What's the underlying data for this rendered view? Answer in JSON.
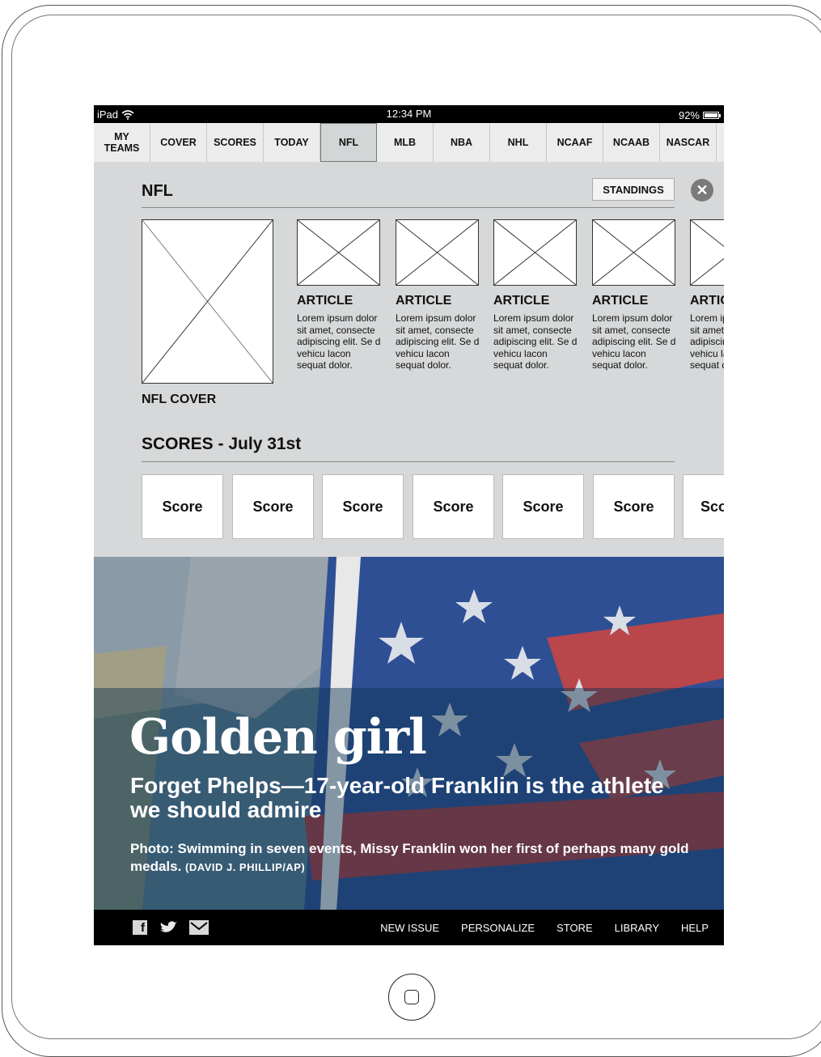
{
  "status_bar": {
    "device": "iPad",
    "time": "12:34 PM",
    "battery": "92%"
  },
  "tabs": [
    {
      "label": "MY TEAMS",
      "active": false
    },
    {
      "label": "COVER",
      "active": false
    },
    {
      "label": "SCORES",
      "active": false
    },
    {
      "label": "TODAY",
      "active": false
    },
    {
      "label": "NFL",
      "active": true
    },
    {
      "label": "MLB",
      "active": false
    },
    {
      "label": "NBA",
      "active": false
    },
    {
      "label": "NHL",
      "active": false
    },
    {
      "label": "NCAAF",
      "active": false
    },
    {
      "label": "NCAAB",
      "active": false
    },
    {
      "label": "NASCAR",
      "active": false
    }
  ],
  "panel": {
    "title": "NFL",
    "standings_label": "STANDINGS",
    "close_icon": "close-circle-icon",
    "cover_label": "NFL COVER",
    "articles": [
      {
        "title": "ARTICLE",
        "body": "Lorem ipsum dolor sit amet, consecte adipiscing elit. Se d vehicu lacon sequat dolor."
      },
      {
        "title": "ARTICLE",
        "body": "Lorem ipsum dolor sit amet, consecte adipiscing elit. Se d vehicu lacon sequat dolor."
      },
      {
        "title": "ARTICLE",
        "body": "Lorem ipsum dolor sit amet, consecte adipiscing elit. Se d vehicu lacon sequat dolor."
      },
      {
        "title": "ARTICLE",
        "body": "Lorem ipsum dolor sit amet, consecte adipiscing elit. Se d vehicu lacon sequat dolor."
      },
      {
        "title": "ARTICLE",
        "body": "Lorem ipsum dolor sit amet, consecte adipiscing elit. Se d vehicu lacon sequat dolor."
      }
    ],
    "scores_title": "SCORES - July 31st",
    "scores": [
      "Score",
      "Score",
      "Score",
      "Score",
      "Score",
      "Score",
      "Score"
    ]
  },
  "feature": {
    "headline": "Golden girl",
    "dek": "Forget Phelps—17-year-old Franklin is the athlete we should admire",
    "caption": "Photo: Swimming in seven events, Missy Franklin won her first of perhaps many gold medals.",
    "credit": "(DAVID J. PHILLIP/AP)"
  },
  "footer": {
    "social_icons": [
      "facebook-icon",
      "twitter-icon",
      "email-icon"
    ],
    "nav": [
      "NEW ISSUE",
      "PERSONALIZE",
      "STORE",
      "LIBRARY",
      "HELP"
    ]
  }
}
